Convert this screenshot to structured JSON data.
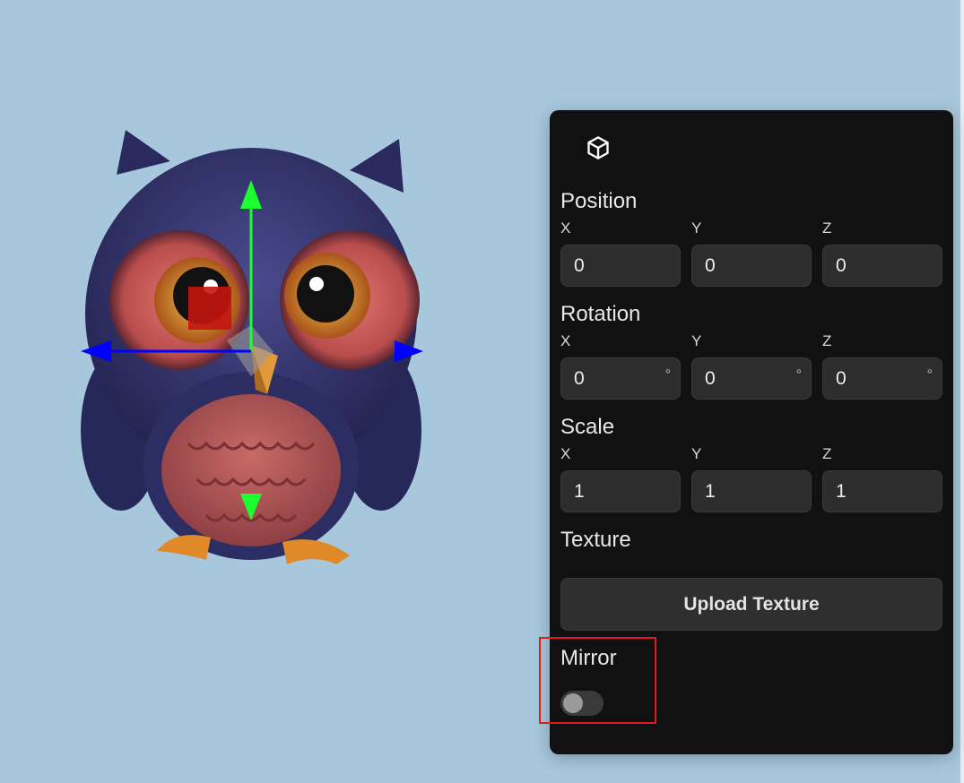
{
  "colors": {
    "viewport_background": "#a7c7dc",
    "panel_background": "#111111",
    "field_background": "#2d2d2d",
    "gizmo_x_axis": "#0000ff",
    "gizmo_y_axis": "#00ff2a",
    "highlight": "#e21b1b"
  },
  "scene": {
    "object": "owl-model",
    "gizmo": "translate-gizmo"
  },
  "panel": {
    "header_icon": "cube-icon",
    "position": {
      "title": "Position",
      "x_label": "X",
      "y_label": "Y",
      "z_label": "Z",
      "x": "0",
      "y": "0",
      "z": "0"
    },
    "rotation": {
      "title": "Rotation",
      "x_label": "X",
      "y_label": "Y",
      "z_label": "Z",
      "x": "0",
      "y": "0",
      "z": "0",
      "unit": "°"
    },
    "scale": {
      "title": "Scale",
      "x_label": "X",
      "y_label": "Y",
      "z_label": "Z",
      "x": "1",
      "y": "1",
      "z": "1"
    },
    "texture": {
      "title": "Texture",
      "upload_label": "Upload Texture"
    },
    "mirror": {
      "title": "Mirror",
      "enabled": false
    }
  }
}
